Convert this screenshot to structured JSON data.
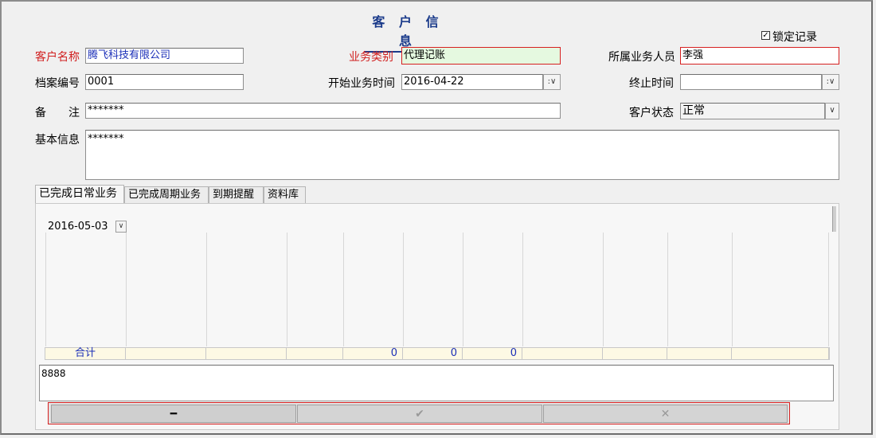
{
  "title": "客 户 信 息",
  "lock_record": {
    "label": "锁定记录",
    "checked": true
  },
  "fields": {
    "customer_name": {
      "label": "客户名称",
      "value": "腾飞科技有限公司"
    },
    "business_type": {
      "label": "业务类别",
      "value": "代理记账"
    },
    "salesperson": {
      "label": "所属业务人员",
      "value": "李强"
    },
    "file_no": {
      "label": "档案编号",
      "value": "0001"
    },
    "start_time": {
      "label": "开始业务时间",
      "value": "2016-04-22"
    },
    "end_time": {
      "label": "终止时间",
      "value": ""
    },
    "remark": {
      "label_1": "备",
      "label_2": "注",
      "value": "*******"
    },
    "status": {
      "label": "客户状态",
      "value": "正常"
    },
    "basic_info": {
      "label": "基本信息",
      "value": "*******"
    }
  },
  "tabs": [
    {
      "label": "已完成日常业务",
      "active": true
    },
    {
      "label": "已完成周期业务",
      "active": false
    },
    {
      "label": "到期提醒",
      "active": false
    },
    {
      "label": "资料库",
      "active": false
    }
  ],
  "grid": {
    "date_filter": "2016-05-03",
    "total_label": "合计",
    "total_values": [
      "0",
      "0",
      "0"
    ]
  },
  "note_text": "8888",
  "buttons": {
    "minus": "━",
    "confirm": "✔",
    "cancel": "✕"
  },
  "icons": {
    "dropdown": "chevron-down-icon",
    "check": "checkbox-check-icon"
  }
}
